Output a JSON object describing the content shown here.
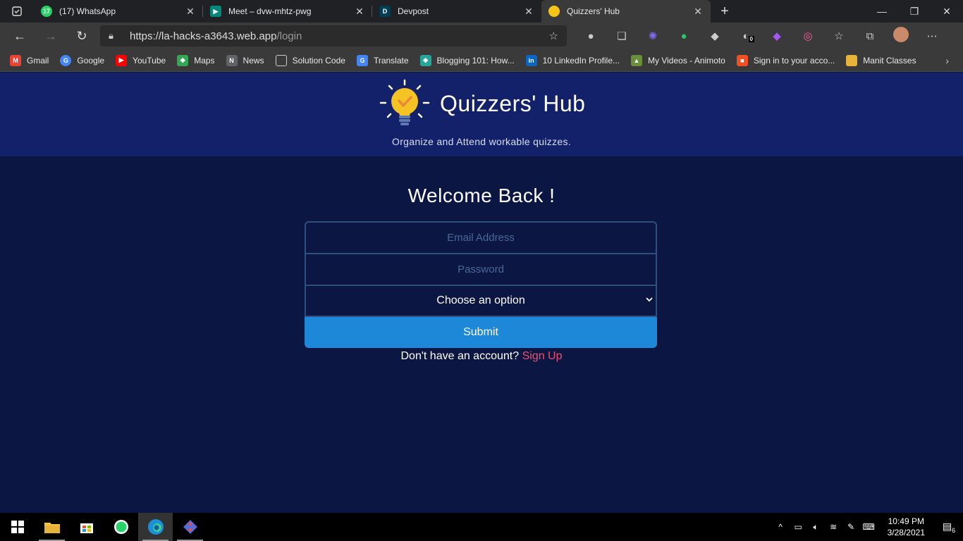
{
  "browser": {
    "tabs": [
      {
        "title": "(17) WhatsApp",
        "badge": "17",
        "color": "#25d366"
      },
      {
        "title": "Meet – dvw-mhtz-pwg",
        "color": "#00897b"
      },
      {
        "title": "Devpost",
        "badge": "D",
        "color": "#003e54"
      },
      {
        "title": "Quizzers' Hub",
        "color": "#f5c518"
      }
    ],
    "url_host": "https://la-hacks-a3643.web.app",
    "url_path": "/login",
    "extension_badge": "0",
    "bookmarks": [
      {
        "label": "Gmail",
        "color": "#ea4335",
        "glyph": "M"
      },
      {
        "label": "Google",
        "color": "#4285f4",
        "glyph": "G"
      },
      {
        "label": "YouTube",
        "color": "#ff0000",
        "glyph": "▶"
      },
      {
        "label": "Maps",
        "color": "#34a853",
        "glyph": "◆"
      },
      {
        "label": "News",
        "color": "#5f6368",
        "glyph": "N"
      },
      {
        "label": "Solution Code",
        "color": "#3a3a3a",
        "glyph": "▭"
      },
      {
        "label": "Translate",
        "color": "#4285f4",
        "glyph": "G"
      },
      {
        "label": "Blogging 101: How...",
        "color": "#26a69a",
        "glyph": "◆"
      },
      {
        "label": "10 LinkedIn Profile...",
        "color": "#0a66c2",
        "glyph": "in"
      },
      {
        "label": "My Videos - Animoto",
        "color": "#6a8f3a",
        "glyph": "▲"
      },
      {
        "label": "Sign in to your acco...",
        "color": "#f25022",
        "glyph": "■"
      },
      {
        "label": "Manit Classes",
        "color": "#e8b339",
        "glyph": "▬"
      }
    ]
  },
  "page": {
    "brand": "Quizzers' Hub",
    "tagline": "Organize and Attend workable quizzes.",
    "welcome": "Welcome Back !",
    "email_placeholder": "Email Address",
    "password_placeholder": "Password",
    "select_value": "Choose an option",
    "submit_label": "Submit",
    "signup_prompt": "Don't have an account?",
    "signup_link": "Sign Up"
  },
  "taskbar": {
    "time": "10:49 PM",
    "date": "3/28/2021",
    "notification_count": "6"
  }
}
